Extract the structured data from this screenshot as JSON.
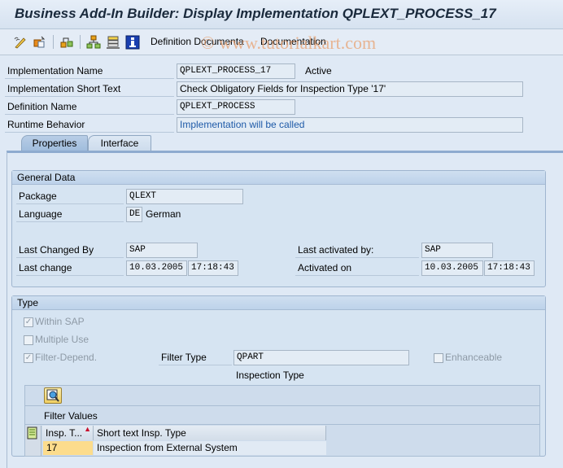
{
  "window": {
    "title": "Business Add-In Builder: Display Implementation QPLEXT_PROCESS_17"
  },
  "toolbar": {
    "icons": [
      "change-display-icon",
      "other-object-icon",
      "where-used-icon",
      "hierarchy-icon",
      "stack-icon",
      "info-icon"
    ],
    "buttons": [
      {
        "label": "Definition Documenta"
      },
      {
        "label": "Documentation"
      }
    ]
  },
  "watermark": "© www.tutorialkart.com",
  "header": {
    "implementation_name": {
      "label": "Implementation Name",
      "value": "QPLEXT_PROCESS_17",
      "status": "Active"
    },
    "implementation_short_text": {
      "label": "Implementation Short Text",
      "value": "Check Obligatory Fields for Inspection Type '17'"
    },
    "definition_name": {
      "label": "Definition Name",
      "value": "QPLEXT_PROCESS"
    },
    "runtime_behavior": {
      "label": "Runtime Behavior",
      "value": "Implementation will be called"
    }
  },
  "tabs": [
    {
      "label": "Properties",
      "active": true
    },
    {
      "label": "Interface",
      "active": false
    }
  ],
  "general_data": {
    "title": "General Data",
    "package": {
      "label": "Package",
      "value": "QLEXT"
    },
    "language": {
      "label": "Language",
      "code": "DE",
      "text": "German"
    },
    "last_changed_by": {
      "label": "Last Changed By",
      "value": "SAP"
    },
    "last_change": {
      "label": "Last change",
      "date": "10.03.2005",
      "time": "17:18:43"
    },
    "last_activated_by": {
      "label": "Last activated by:",
      "value": "SAP"
    },
    "activated_on": {
      "label": "Activated on",
      "date": "10.03.2005",
      "time": "17:18:43"
    }
  },
  "type": {
    "title": "Type",
    "within_sap": {
      "label": "Within SAP",
      "checked": true
    },
    "multiple_use": {
      "label": "Multiple Use",
      "checked": false
    },
    "filter_depend": {
      "label": "Filter-Depend.",
      "checked": true
    },
    "filter_type": {
      "label": "Filter Type",
      "value": "QPART",
      "description": "Inspection Type"
    },
    "enhanceable": {
      "label": "Enhanceable",
      "checked": false
    },
    "filter_values": {
      "title": "Filter Values",
      "columns": [
        "Insp. T...",
        "Short text Insp. Type"
      ],
      "rows": [
        {
          "code": "17",
          "text": "Inspection from External System"
        }
      ]
    }
  },
  "check_marks": {
    "checked": "✓",
    "unchecked": ""
  }
}
